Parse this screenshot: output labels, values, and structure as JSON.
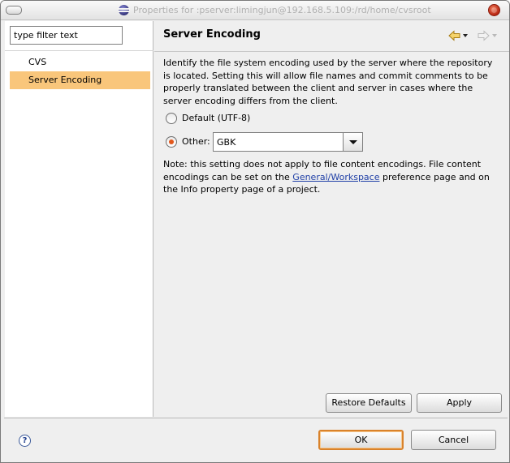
{
  "window": {
    "title": "Properties for :pserver:limingjun@192.168.5.109:/rd/home/cvsroot",
    "icon": "eclipse-logo-icon"
  },
  "filter": {
    "value": "type filter text"
  },
  "tree": {
    "items": [
      {
        "label": "CVS",
        "selected": false
      },
      {
        "label": "Server Encoding",
        "selected": true
      }
    ],
    "selection_color": "#f9c67b"
  },
  "page": {
    "title": "Server Encoding",
    "description": "Identify the file system encoding used by the server where the repository is located. Setting this will allow file names and commit comments to be properly translated between the client and server in cases where the server encoding differs from the client.",
    "options": {
      "default_label": "Default (UTF-8)",
      "default_checked": false,
      "other_label": "Other:",
      "other_checked": true
    },
    "encoding_combo": {
      "selected": "GBK"
    },
    "note": {
      "prefix": "Note: this setting does not apply to file content encodings. File content encodings can be set on the ",
      "link": "General/Workspace",
      "suffix": " preference page and on the Info property page of a project."
    },
    "buttons": {
      "restore_defaults": "Restore Defaults",
      "apply": "Apply"
    }
  },
  "dialog": {
    "ok": "OK",
    "cancel": "Cancel",
    "help_icon": "help-question-icon"
  },
  "colors": {
    "accent": "#e2571c",
    "default_button_border": "#d9822b",
    "link": "#1f3fa6"
  }
}
